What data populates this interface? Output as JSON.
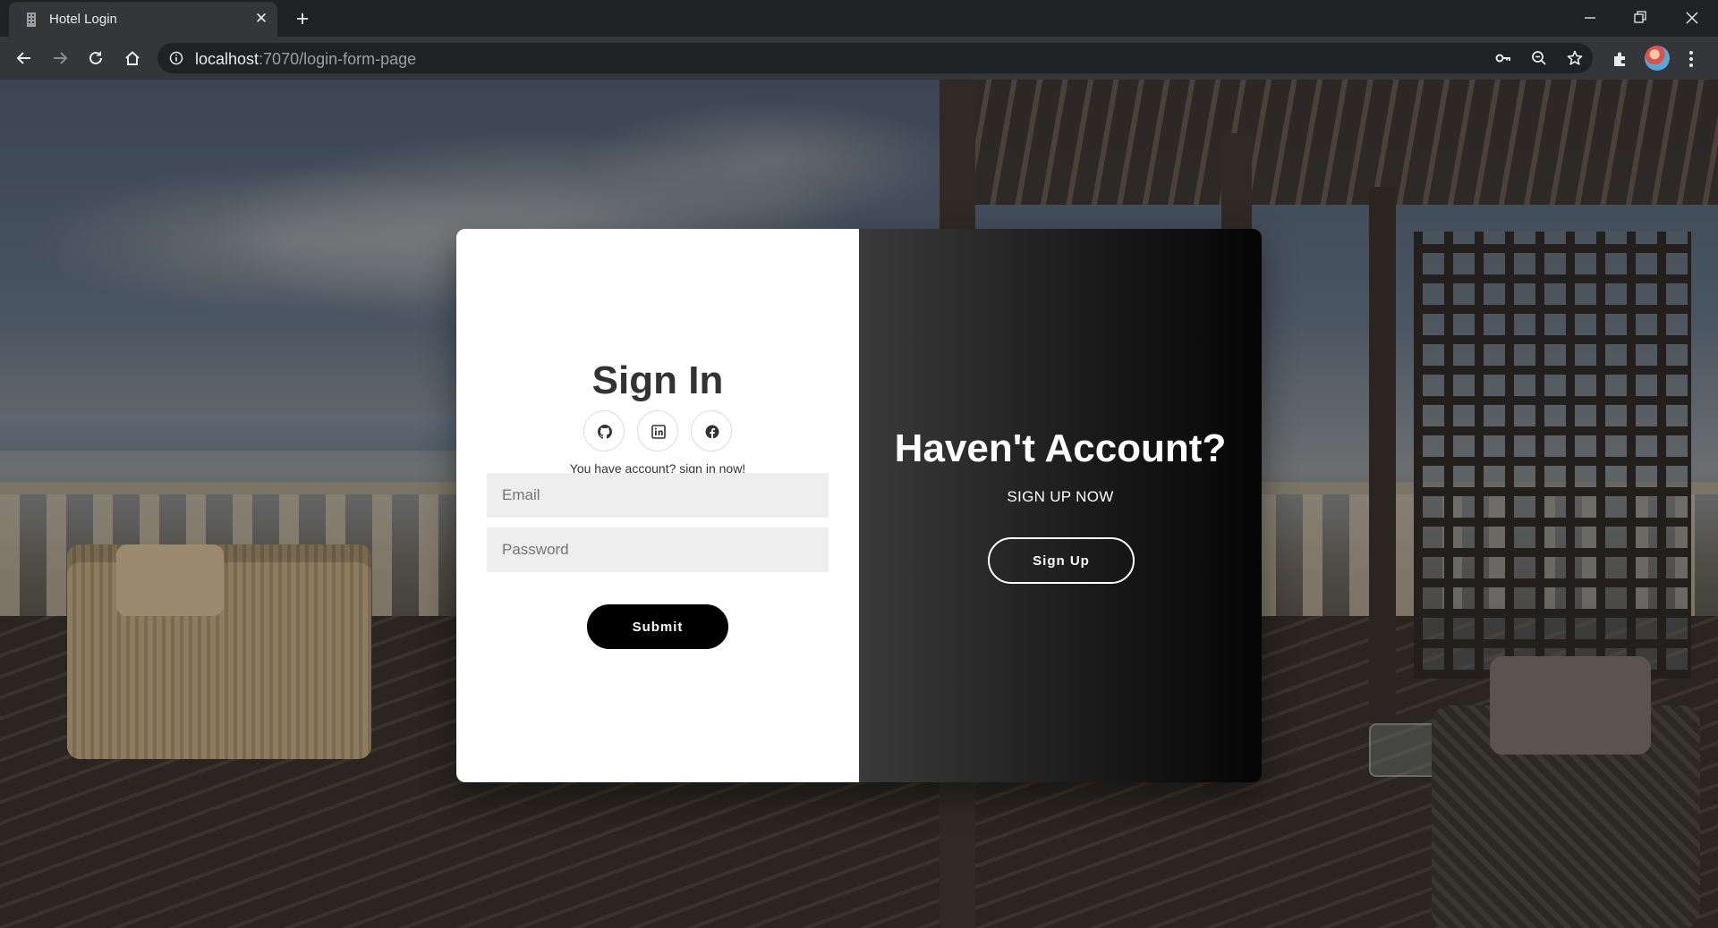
{
  "browser": {
    "tab_title": "Hotel Login",
    "url_host": "localhost",
    "url_path": ":7070/login-form-page"
  },
  "login": {
    "title": "Sign In",
    "social": [
      "github-icon",
      "linkedin-icon",
      "facebook-icon"
    ],
    "hint": "You have account? sign in now!",
    "email_placeholder": "Email",
    "password_placeholder": "Password",
    "submit_label": "Submit"
  },
  "signup_panel": {
    "title": "Haven't Account?",
    "subtitle": "SIGN UP NOW",
    "button_label": "Sign Up"
  },
  "colors": {
    "chrome_dark": "#202124",
    "chrome_toolbar": "#35363a",
    "card_left_bg": "#ffffff",
    "input_bg": "#eeeeee",
    "primary_button": "#000000",
    "right_panel_gradient": [
      "#3a3a3a",
      "#050505"
    ]
  }
}
